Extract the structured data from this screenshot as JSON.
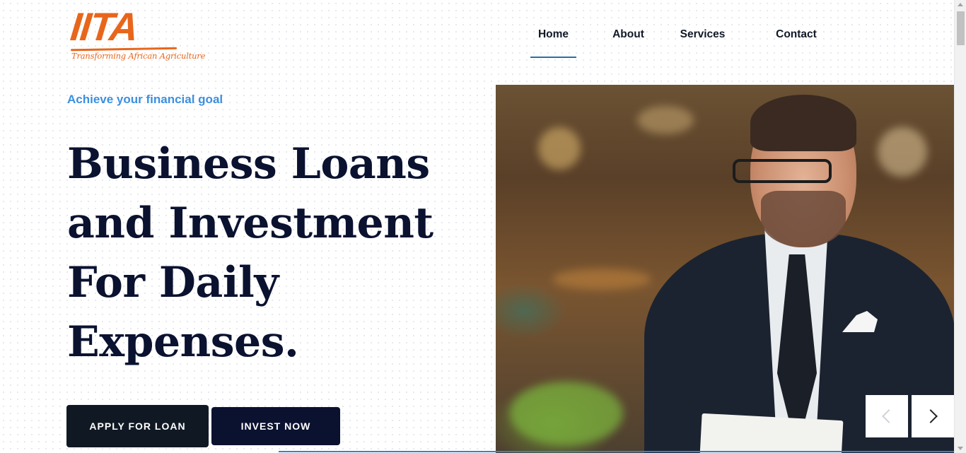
{
  "brand": {
    "logo_text": "IITA",
    "tagline": "Transforming African Agriculture",
    "color": "#e8661b"
  },
  "nav": {
    "items": [
      {
        "label": "Home",
        "active": true
      },
      {
        "label": "About",
        "active": false
      },
      {
        "label": "Services",
        "active": false
      },
      {
        "label": "Contact",
        "active": false
      }
    ]
  },
  "hero": {
    "eyebrow": "Achieve your financial goal",
    "headline_lines": [
      "Business Loans",
      "and Investment",
      "For Daily",
      "Expenses."
    ],
    "buttons": {
      "apply": "APPLY FOR LOAN",
      "invest": "INVEST NOW"
    },
    "image": "businessman-smiling-at-desk"
  },
  "slider": {
    "prev_icon": "chevron-left-icon",
    "next_icon": "chevron-right-icon"
  },
  "colors": {
    "accent": "#3b8fe0",
    "heading": "#0a1230",
    "button_dark": "#101923",
    "button_navy": "#0b1230"
  }
}
